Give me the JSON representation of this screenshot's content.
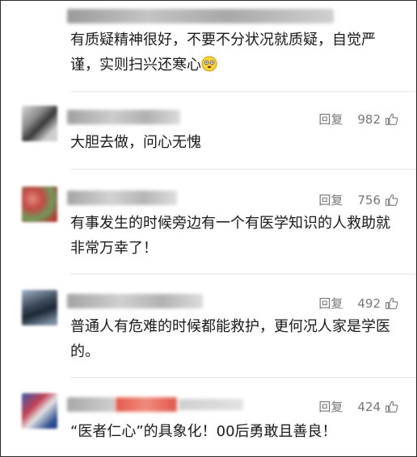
{
  "comments": [
    {
      "text": "有质疑精神很好，不要不分状况就质疑，自觉严谨，实则扫兴还寒心",
      "emoji": "face-with-spiral-eyes-icon"
    },
    {
      "reply_label": "回复",
      "likes": "982",
      "text": "大胆去做，问心无愧"
    },
    {
      "reply_label": "回复",
      "likes": "756",
      "text": "有事发生的时候旁边有一个有医学知识的人救助就非常万幸了！"
    },
    {
      "reply_label": "回复",
      "likes": "492",
      "text": "普通人有危难的时候都能救护，更何况人家是学医的。"
    },
    {
      "reply_label": "回复",
      "likes": "424",
      "text": "“医者仁心”的具象化！00后勇敢且善良！"
    }
  ],
  "colors": {
    "text": "#1a1a1a",
    "meta": "#777777",
    "divider": "#e6e6e6",
    "frame": "#2a2a2a"
  }
}
